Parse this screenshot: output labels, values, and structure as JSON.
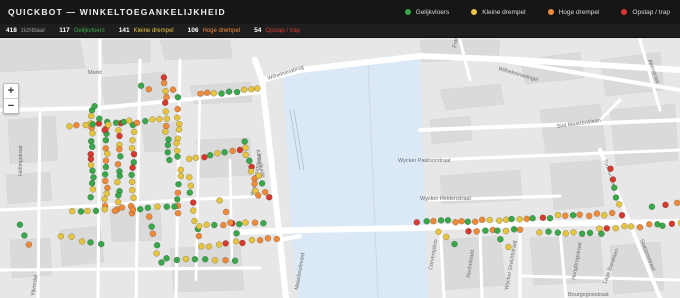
{
  "header": {
    "title": "QUICKBOT — WINKELTOEGANKELIJKHEID",
    "legend": [
      {
        "label": "Gelijkvloers",
        "color": "#3aa84a"
      },
      {
        "label": "Kleine drempel",
        "color": "#e6c440"
      },
      {
        "label": "Hoge drempel",
        "color": "#ef8a3a"
      },
      {
        "label": "Opstap / trap",
        "color": "#d63a2e"
      }
    ]
  },
  "stats": {
    "total_count": "418",
    "total_label": "zichtbaar",
    "items": [
      {
        "count": "117",
        "label": "Gelijkvloers",
        "color": "#3aa84a"
      },
      {
        "count": "141",
        "label": "Kleine drempel",
        "color": "#e6c440"
      },
      {
        "count": "106",
        "label": "Hoge drempel",
        "color": "#ef8a3a"
      },
      {
        "count": "54",
        "label": "Opstap / trap",
        "color": "#d63a2e"
      }
    ]
  },
  "map": {
    "zoom_in": "+",
    "zoom_out": "−",
    "streets": [
      "Markt",
      "Wilhelminabrug",
      "Hellingstraat",
      "Maasboulevard",
      "Wyckerbrugstraat",
      "Wycker Pastoorstraat",
      "Wycker Heidenstraat",
      "Sint Maartenslaan",
      "Wilhelminasingel",
      "Rechtstraat",
      "Bourgognestraat",
      "Cörversplein",
      "Wycker Grachtstraat",
      "Hoogbrugstraat",
      "Lage Barakken",
      "Stationsstraat",
      "Timmerstraat",
      "Akerstraat",
      "Franciscus Romanusweg",
      "Kesselkade",
      "Vijverdal"
    ]
  },
  "icons": {
    "zoom_in": "plus-icon",
    "zoom_out": "minus-icon"
  }
}
